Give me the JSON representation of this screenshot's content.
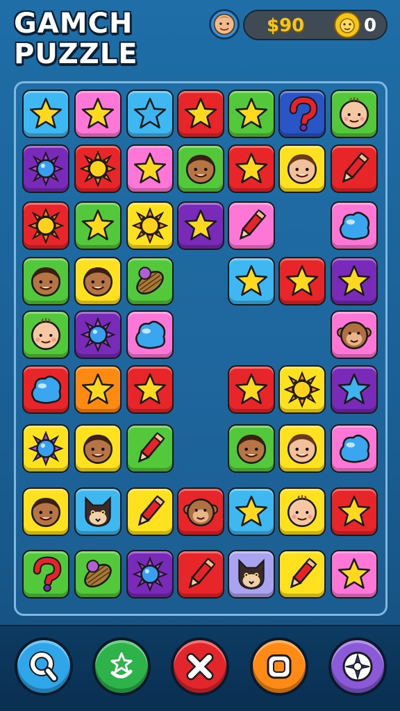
{
  "title": {
    "line1": "GAMCH",
    "line2": "PUZZLE"
  },
  "hud": {
    "money": "$90",
    "count": "0",
    "avatar_icon": "player-avatar-icon",
    "currency_icon": "lion-coin-icon"
  },
  "colors": {
    "blue": "#3fb7f0",
    "pink": "#ff77d6",
    "red": "#e8262a",
    "green": "#52c83a",
    "navy": "#2a55c7",
    "purple": "#7a2ab8",
    "yellow": "#ffe11f",
    "orange": "#ff8a12",
    "lavender": "#a9a3f0"
  },
  "board": {
    "rows": [
      [
        {
          "c": "blue",
          "i": "star"
        },
        {
          "c": "pink",
          "i": "star"
        },
        {
          "c": "blue",
          "i": "star-blue"
        },
        {
          "c": "red",
          "i": "star"
        },
        {
          "c": "green",
          "i": "star"
        },
        {
          "c": "navy",
          "i": "question"
        },
        {
          "c": "green",
          "i": "baby"
        }
      ],
      [
        {
          "c": "purple",
          "i": "gem"
        },
        {
          "c": "red",
          "i": "sun"
        },
        {
          "c": "pink",
          "i": "star"
        },
        {
          "c": "green",
          "i": "face"
        },
        {
          "c": "red",
          "i": "star"
        },
        {
          "c": "yellow",
          "i": "boy"
        },
        {
          "c": "red",
          "i": "pencil"
        }
      ],
      [
        {
          "c": "red",
          "i": "sun"
        },
        {
          "c": "green",
          "i": "star"
        },
        {
          "c": "yellow",
          "i": "sun"
        },
        {
          "c": "purple",
          "i": "star"
        },
        {
          "c": "pink",
          "i": "pencil"
        },
        null,
        {
          "c": "pink",
          "i": "blob"
        }
      ],
      [
        {
          "c": "green",
          "i": "face"
        },
        {
          "c": "yellow",
          "i": "face"
        },
        {
          "c": "green",
          "i": "nut"
        },
        null,
        {
          "c": "blue",
          "i": "star"
        },
        {
          "c": "red",
          "i": "star"
        },
        {
          "c": "purple",
          "i": "star"
        }
      ],
      [
        {
          "c": "green",
          "i": "baby"
        },
        {
          "c": "purple",
          "i": "gem"
        },
        {
          "c": "pink",
          "i": "blob"
        },
        null,
        null,
        null,
        {
          "c": "pink",
          "i": "monkey"
        }
      ],
      [
        {
          "c": "red",
          "i": "blob"
        },
        {
          "c": "orange",
          "i": "star"
        },
        {
          "c": "red",
          "i": "star"
        },
        null,
        {
          "c": "red",
          "i": "star"
        },
        {
          "c": "yellow",
          "i": "sun"
        },
        {
          "c": "purple",
          "i": "star-blue"
        }
      ],
      [
        {
          "c": "yellow",
          "i": "gem"
        },
        {
          "c": "yellow",
          "i": "face"
        },
        {
          "c": "green",
          "i": "pencil"
        },
        null,
        {
          "c": "green",
          "i": "face"
        },
        {
          "c": "yellow",
          "i": "boy"
        },
        {
          "c": "pink",
          "i": "blob"
        }
      ],
      [
        {
          "c": "yellow",
          "i": "face"
        },
        {
          "c": "blue",
          "i": "cat"
        },
        {
          "c": "yellow",
          "i": "pencil"
        },
        {
          "c": "red",
          "i": "monkey"
        },
        {
          "c": "blue",
          "i": "star"
        },
        {
          "c": "yellow",
          "i": "baby"
        },
        {
          "c": "red",
          "i": "star"
        }
      ],
      [
        {
          "c": "green",
          "i": "question"
        },
        {
          "c": "green",
          "i": "nut"
        },
        {
          "c": "purple",
          "i": "gem"
        },
        {
          "c": "red",
          "i": "pencil"
        },
        {
          "c": "lavender",
          "i": "cat"
        },
        {
          "c": "yellow",
          "i": "pencil"
        },
        {
          "c": "pink",
          "i": "star"
        }
      ]
    ]
  },
  "buttons": [
    {
      "name": "search-button",
      "icon": "search-icon",
      "color": "#2fa6ea"
    },
    {
      "name": "refresh-button",
      "icon": "refresh-icon",
      "color": "#2db34a"
    },
    {
      "name": "close-button",
      "icon": "close-icon",
      "color": "#e3262b"
    },
    {
      "name": "stop-button",
      "icon": "square-icon",
      "color": "#ff8b16"
    },
    {
      "name": "compass-button",
      "icon": "compass-icon",
      "color": "#8a5ad9"
    }
  ]
}
